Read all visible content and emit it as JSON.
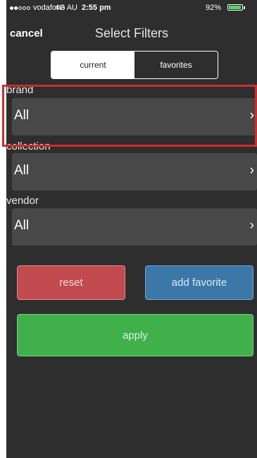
{
  "status_bar": {
    "carrier": "vodafone AU",
    "network": "4G",
    "time": "2:55 pm",
    "battery_percent": "92%",
    "battery_level": 0.92,
    "signal_bars_filled": 2,
    "signal_bars_total": 5
  },
  "header": {
    "cancel_label": "cancel",
    "title": "Select Filters"
  },
  "segmented_control": {
    "options": [
      "current",
      "favorites"
    ],
    "selected": "current"
  },
  "filters": [
    {
      "label": "brand",
      "value": "All",
      "chevron": "›"
    },
    {
      "label": "collection",
      "value": "All",
      "chevron": "›"
    },
    {
      "label": "vendor",
      "value": "All",
      "chevron": "›"
    }
  ],
  "buttons": {
    "reset_label": "reset",
    "add_favorite_label": "add favorite",
    "apply_label": "apply"
  },
  "colors": {
    "background": "#2e2e2e",
    "filter_row": "#484848",
    "reset": "#c14a4e",
    "add_favorite": "#3b78a8",
    "apply": "#3fb04a",
    "highlight_box": "#d12b2b"
  }
}
